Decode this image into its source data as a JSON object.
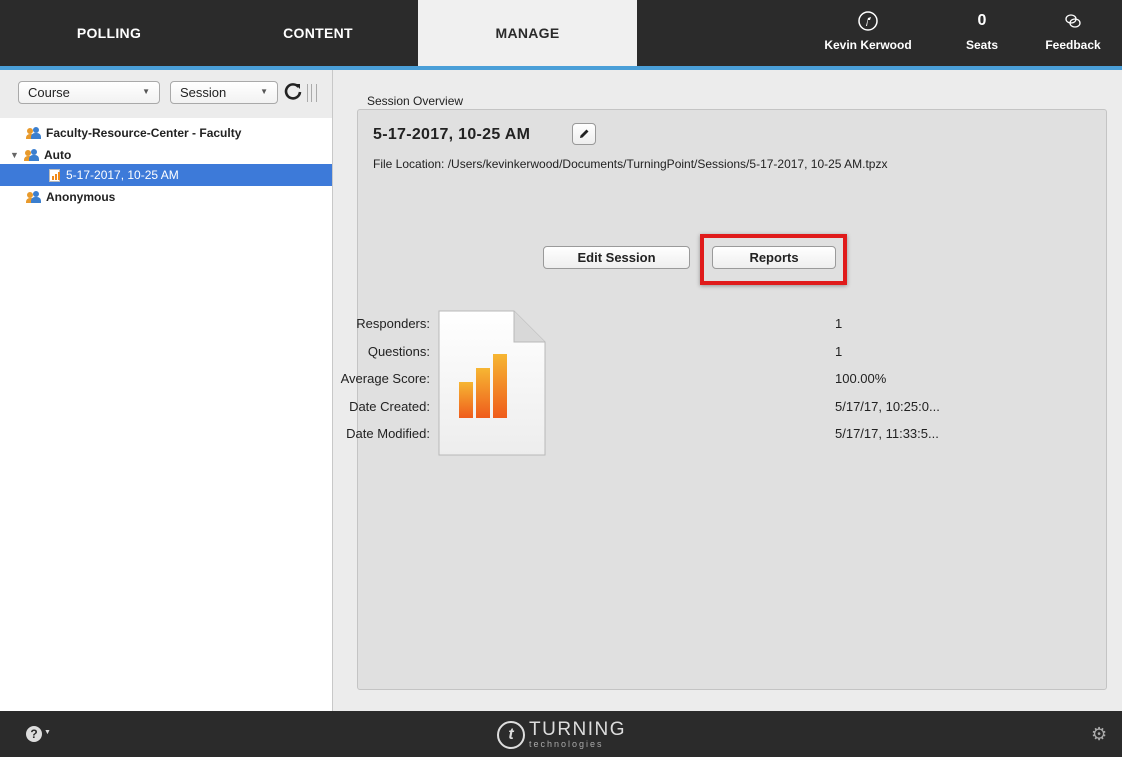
{
  "nav": {
    "tabs": [
      {
        "label": "POLLING"
      },
      {
        "label": "CONTENT"
      },
      {
        "label": "MANAGE"
      }
    ],
    "user": {
      "name": "Kevin Kerwood",
      "icon": "turning-logo-icon"
    },
    "seats": {
      "count": "0",
      "label": "Seats"
    },
    "feedback": {
      "label": "Feedback",
      "icon": "chat-bubbles-icon"
    },
    "accent_color": "#4a9fd8"
  },
  "sidebar": {
    "course_select": "Course",
    "session_select": "Session",
    "tree": [
      {
        "label": "Faculty-Resource-Center - Faculty",
        "type": "group"
      },
      {
        "label": "Auto",
        "type": "group",
        "expanded": true
      },
      {
        "label": "5-17-2017, 10-25 AM",
        "type": "session",
        "selected": true
      },
      {
        "label": "Anonymous",
        "type": "group"
      }
    ]
  },
  "main": {
    "section_label": "Session Overview",
    "session_title": "5-17-2017, 10-25 AM",
    "file_location": "File Location: /Users/kevinkerwood/Documents/TurningPoint/Sessions/5-17-2017, 10-25 AM.tpzx",
    "edit_session_label": "Edit Session",
    "reports_label": "Reports",
    "highlight_color": "#e01b1b",
    "stats": [
      {
        "key": "Responders:",
        "value": "1"
      },
      {
        "key": "Questions:",
        "value": "1"
      },
      {
        "key": "Average Score:",
        "value": "100.00%"
      },
      {
        "key": "Date Created:",
        "value": "5/17/17, 10:25:0..."
      },
      {
        "key": "Date Modified:",
        "value": "5/17/17, 11:33:5..."
      }
    ]
  },
  "footer": {
    "logo_word": "TURNING",
    "logo_sub": "technologies",
    "help_icon": "help-icon",
    "settings_icon": "gear-icon"
  }
}
